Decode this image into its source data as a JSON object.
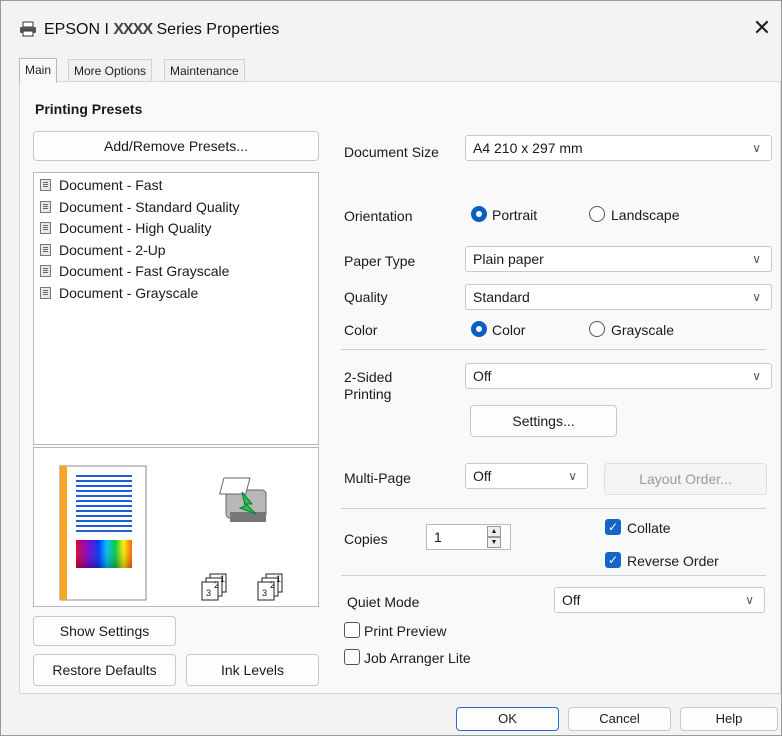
{
  "window": {
    "title_prefix": "EPSON I ",
    "title_model": "XXXX",
    "title_suffix": " Series Properties",
    "close_glyph": "✕"
  },
  "tabs": [
    {
      "label": "Main",
      "active": true
    },
    {
      "label": "More Options",
      "active": false
    },
    {
      "label": "Maintenance",
      "active": false
    }
  ],
  "presets": {
    "heading": "Printing Presets",
    "add_remove_label": "Add/Remove Presets...",
    "items": [
      "Document - Fast",
      "Document - Standard Quality",
      "Document - High Quality",
      "Document - 2-Up",
      "Document - Fast Grayscale",
      "Document - Grayscale"
    ]
  },
  "left_buttons": {
    "show_settings": "Show Settings",
    "restore_defaults": "Restore Defaults",
    "ink_levels": "Ink Levels"
  },
  "settings": {
    "document_size": {
      "label": "Document Size",
      "value": "A4 210 x 297 mm"
    },
    "orientation": {
      "label": "Orientation",
      "portrait": "Portrait",
      "landscape": "Landscape",
      "selected": "Portrait"
    },
    "paper_type": {
      "label": "Paper Type",
      "value": "Plain paper"
    },
    "quality": {
      "label": "Quality",
      "value": "Standard"
    },
    "color": {
      "label": "Color",
      "color_option": "Color",
      "grayscale_option": "Grayscale",
      "selected": "Color"
    },
    "two_sided": {
      "label_line1": "2-Sided",
      "label_line2": "Printing",
      "value": "Off",
      "settings_button": "Settings..."
    },
    "multi_page": {
      "label": "Multi-Page",
      "value": "Off",
      "layout_order_button": "Layout Order..."
    },
    "copies": {
      "label": "Copies",
      "value": "1",
      "collate": "Collate",
      "collate_checked": true,
      "reverse_order": "Reverse Order",
      "reverse_checked": true
    },
    "quiet_mode": {
      "label": "Quiet Mode",
      "value": "Off"
    },
    "print_preview": {
      "label": "Print Preview",
      "checked": false
    },
    "job_arranger": {
      "label": "Job Arranger Lite",
      "checked": false
    }
  },
  "footer": {
    "ok": "OK",
    "cancel": "Cancel",
    "help": "Help"
  },
  "colors": {
    "accent": "#0a5fc4",
    "check_fill": "#1565c8",
    "page_stripe": "#f5a623",
    "text_lines": "#1f5fd6"
  }
}
